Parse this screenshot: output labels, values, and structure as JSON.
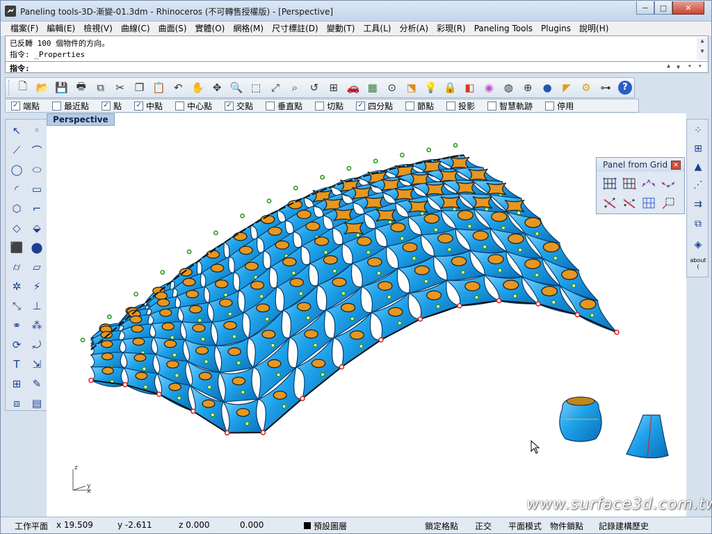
{
  "window": {
    "title": "Paneling tools-3D-漸變-01.3dm - Rhinoceros (不可轉售授權版) - [Perspective]",
    "minimize_label": "−",
    "maximize_label": "□",
    "close_label": "✕"
  },
  "menu": {
    "items": [
      {
        "label": "檔案(F)"
      },
      {
        "label": "編輯(E)"
      },
      {
        "label": "檢視(V)"
      },
      {
        "label": "曲線(C)"
      },
      {
        "label": "曲面(S)"
      },
      {
        "label": "實體(O)"
      },
      {
        "label": "網格(M)"
      },
      {
        "label": "尺寸標註(D)"
      },
      {
        "label": "變動(T)"
      },
      {
        "label": "工具(L)"
      },
      {
        "label": "分析(A)"
      },
      {
        "label": "彩現(R)"
      },
      {
        "label": "Paneling Tools"
      },
      {
        "label": "Plugins"
      },
      {
        "label": "說明(H)"
      }
    ]
  },
  "command": {
    "history": [
      "已反轉 100 個物件的方向。",
      "指令: _Properties"
    ],
    "prompt_label": "指令:"
  },
  "osnap": {
    "items": [
      {
        "label": "端點",
        "checked": true
      },
      {
        "label": "最近點",
        "checked": false
      },
      {
        "label": "點",
        "checked": true
      },
      {
        "label": "中點",
        "checked": true
      },
      {
        "label": "中心點",
        "checked": false
      },
      {
        "label": "交點",
        "checked": true
      },
      {
        "label": "垂直點",
        "checked": false
      },
      {
        "label": "切點",
        "checked": false
      },
      {
        "label": "四分點",
        "checked": true
      },
      {
        "label": "節點",
        "checked": false
      },
      {
        "label": "投影",
        "checked": false
      },
      {
        "label": "智慧軌跡",
        "checked": false
      },
      {
        "label": "停用",
        "checked": false
      }
    ]
  },
  "viewport": {
    "label": "Perspective",
    "axis_z": "z",
    "axis_y": "y",
    "axis_x": "x"
  },
  "panel_from_grid": {
    "title": "Panel from Grid",
    "close_label": "✕"
  },
  "right_toolbar": {
    "about_label": "about ("
  },
  "status": {
    "cplane": "工作平面",
    "x": "x 19.509",
    "y": "y -2.611",
    "z": "z 0.000",
    "extra": "0.000",
    "layer": "預設圖層",
    "grid_snap": "鎖定格點",
    "ortho": "正交",
    "planar": "平面模式",
    "osnap": "物件鎖點",
    "history": "記錄建構歷史"
  },
  "watermark": "www.surface3d.com.tw",
  "colors": {
    "panel_blue": "#1aa0e8",
    "panel_orange": "#e8961e",
    "point_green": "#2a9a1a",
    "point_red": "#d42020",
    "edge_black": "#111111"
  }
}
